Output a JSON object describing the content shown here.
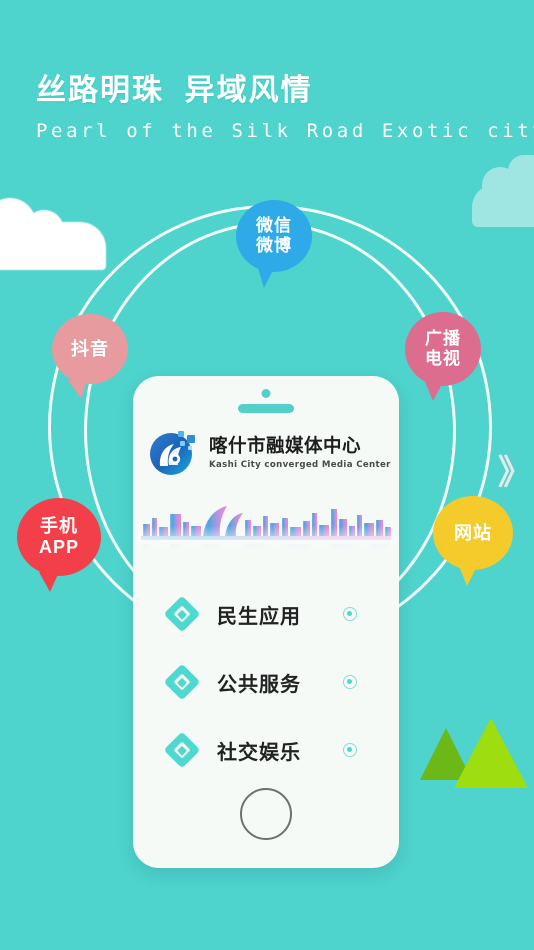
{
  "page": {
    "background_color": "#4ed3cd"
  },
  "header": {
    "title_cn": "丝路明珠  异域风情",
    "title_en": "Pearl of the Silk Road Exotic city"
  },
  "phone": {
    "brand": {
      "name_cn": "喀什市融媒体中心",
      "name_en": "Kashi City converged Media Center"
    },
    "menu": [
      {
        "label": "民生应用"
      },
      {
        "label": "公共服务"
      },
      {
        "label": "社交娱乐"
      }
    ]
  },
  "bubbles": [
    {
      "key": "wechat",
      "label": "微信\n微博",
      "color": "#2eaae8"
    },
    {
      "key": "douyin",
      "label": "抖音",
      "color": "#e79b9e"
    },
    {
      "key": "radio_tv",
      "label": "广播\n电视",
      "color": "#dd6d8e"
    },
    {
      "key": "mobile_app",
      "label": "手机\nAPP",
      "color": "#f23f49"
    },
    {
      "key": "website",
      "label": "网站",
      "color": "#f5cb2b"
    }
  ],
  "decor": {
    "chevrons": "》"
  }
}
